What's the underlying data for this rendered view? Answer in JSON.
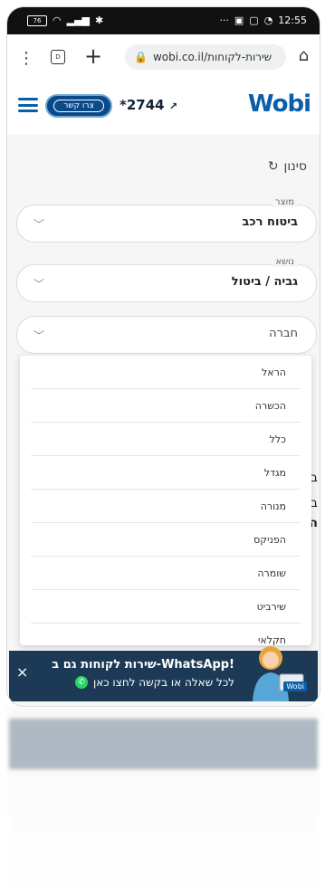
{
  "status_bar": {
    "time": "12:55",
    "battery": "76"
  },
  "browser": {
    "url": "wobi.co.il/שירות-לקוחות"
  },
  "header": {
    "contact_label": "צרו קשר",
    "phone": "*2744",
    "logo": "Wobi"
  },
  "filter": {
    "title": "סינון",
    "product": {
      "label": "מוצר",
      "value": "ביטוח רכב"
    },
    "topic": {
      "label": "נושא",
      "value": "גביה / ביטול"
    },
    "company": {
      "placeholder": "חברה"
    }
  },
  "dropdown": {
    "options": [
      "הראל",
      "הכשרה",
      "כלל",
      "מגדל",
      "מנורה",
      "הפניקס",
      "שומרה",
      "שירביט",
      "חקלאי"
    ]
  },
  "peek": {
    "a": "ב",
    "b": "ב",
    "c": "ה",
    "d": "ב"
  },
  "whatsapp": {
    "title": "שירות לקוחות גם ב-WhatsApp!",
    "subtitle": "לכל שאלה או בקשה לחצו כאן",
    "close": "×",
    "badge": "Wobi"
  },
  "colors": {
    "brand": "#0a5fa8",
    "accent": "#f29c12",
    "banner": "#1c3a55",
    "whatsapp": "#25d366"
  }
}
